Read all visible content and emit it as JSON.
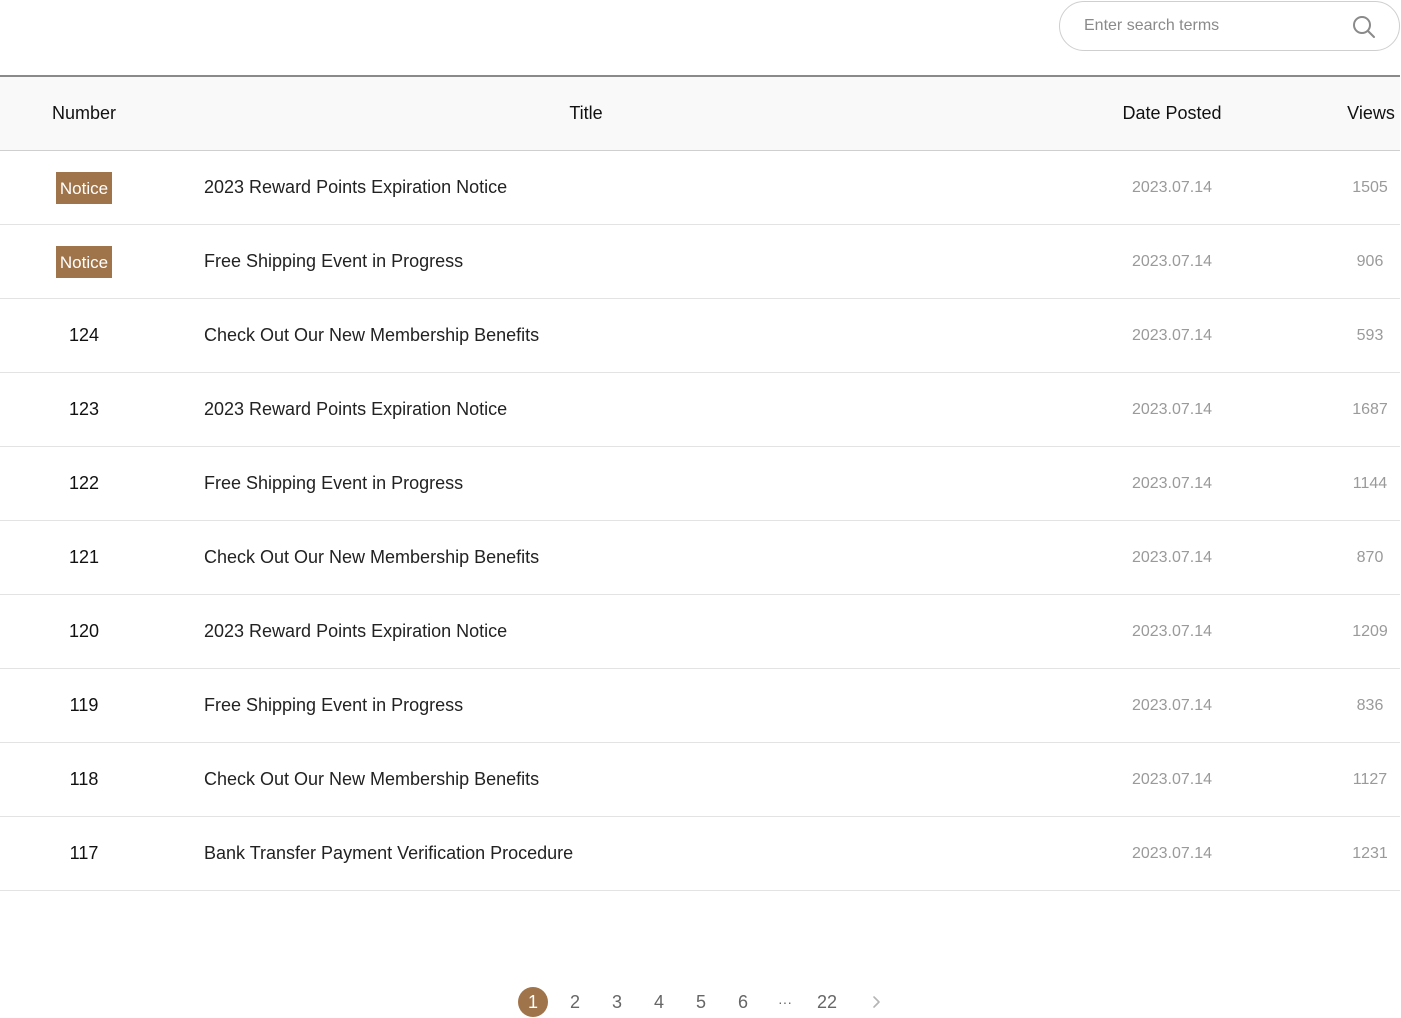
{
  "search": {
    "placeholder": "Enter search terms",
    "icon": "search-icon"
  },
  "table": {
    "headers": {
      "number": "Number",
      "title": "Title",
      "date": "Date Posted",
      "views": "Views"
    },
    "rows": [
      {
        "number": "Notice",
        "is_notice": true,
        "title": "2023 Reward Points Expiration Notice",
        "date": "2023.07.14",
        "views": "1505"
      },
      {
        "number": "Notice",
        "is_notice": true,
        "title": "Free Shipping Event in Progress",
        "date": "2023.07.14",
        "views": "906"
      },
      {
        "number": "124",
        "is_notice": false,
        "title": "Check Out Our New Membership Benefits",
        "date": "2023.07.14",
        "views": "593"
      },
      {
        "number": "123",
        "is_notice": false,
        "title": "2023 Reward Points Expiration Notice",
        "date": "2023.07.14",
        "views": "1687"
      },
      {
        "number": "122",
        "is_notice": false,
        "title": "Free Shipping Event in Progress",
        "date": "2023.07.14",
        "views": "1144"
      },
      {
        "number": "121",
        "is_notice": false,
        "title": "Check Out Our New Membership Benefits",
        "date": "2023.07.14",
        "views": "870"
      },
      {
        "number": "120",
        "is_notice": false,
        "title": "2023 Reward Points Expiration Notice",
        "date": "2023.07.14",
        "views": "1209"
      },
      {
        "number": "119",
        "is_notice": false,
        "title": "Free Shipping Event in Progress",
        "date": "2023.07.14",
        "views": "836"
      },
      {
        "number": "118",
        "is_notice": false,
        "title": "Check Out Our New Membership Benefits",
        "date": "2023.07.14",
        "views": "1127"
      },
      {
        "number": "117",
        "is_notice": false,
        "title": "Bank Transfer Payment Verification Procedure",
        "date": "2023.07.14",
        "views": "1231"
      }
    ]
  },
  "pagination": {
    "pages": [
      "1",
      "2",
      "3",
      "4",
      "5",
      "6"
    ],
    "ellipsis": "···",
    "last": "22",
    "current": "1",
    "next_icon": "chevron-right-icon"
  },
  "colors": {
    "accent": "#a0744a",
    "muted_text": "#9a9a9a",
    "header_bg": "#f9f9f9"
  }
}
